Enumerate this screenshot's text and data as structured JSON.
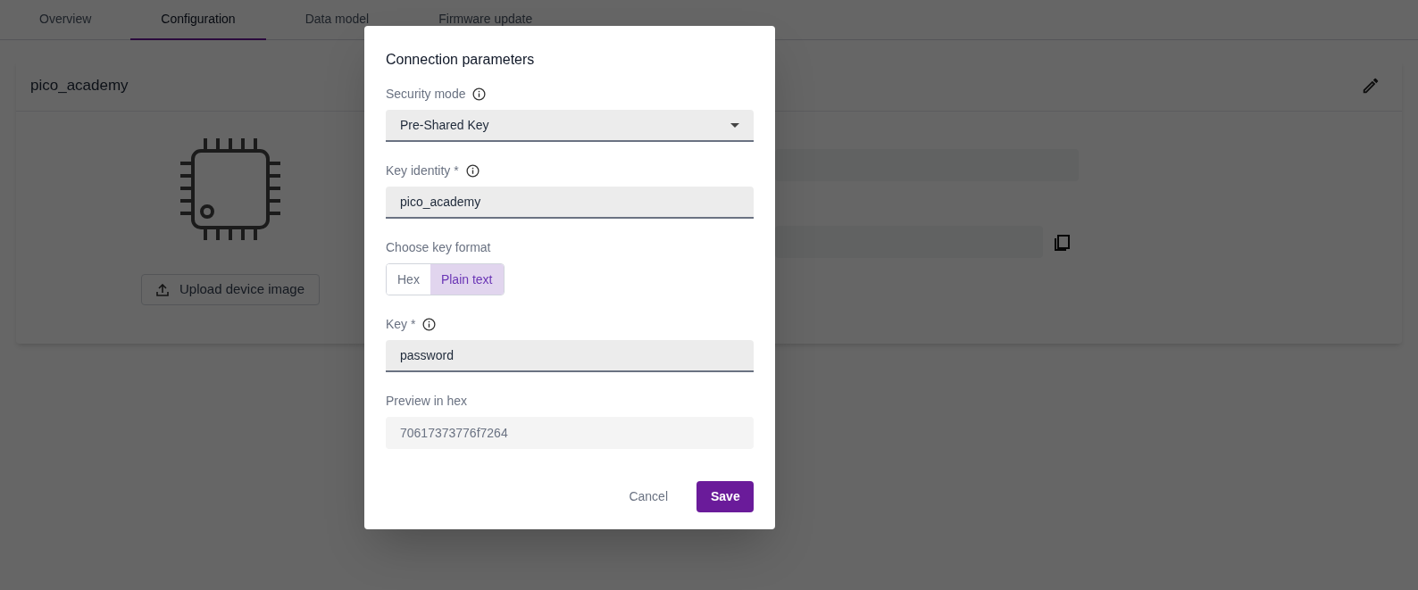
{
  "tabs": [
    {
      "label": "Overview",
      "selected": false
    },
    {
      "label": "Configuration",
      "selected": true
    },
    {
      "label": "Data model",
      "selected": false
    },
    {
      "label": "Firmware update",
      "selected": false
    }
  ],
  "device_card": {
    "title": "pico_academy",
    "upload_button": "Upload device image"
  },
  "dialog": {
    "title": "Connection parameters",
    "fields": [
      {
        "kind": "select",
        "label": "Security mode",
        "value": "Pre-Shared Key"
      },
      {
        "kind": "input",
        "label": "Key identity *",
        "value": "pico_academy"
      },
      {
        "kind": "toggle",
        "label": "Choose key format",
        "options": [
          {
            "label": "Hex",
            "selected": false
          },
          {
            "label": "Plain text",
            "selected": true
          }
        ]
      },
      {
        "kind": "input",
        "label": "Key *",
        "value": "password"
      },
      {
        "kind": "readonly",
        "label": "Preview in hex",
        "value": "70617373776f7264"
      }
    ],
    "buttons": {
      "cancel": "Cancel",
      "save": "Save"
    }
  }
}
